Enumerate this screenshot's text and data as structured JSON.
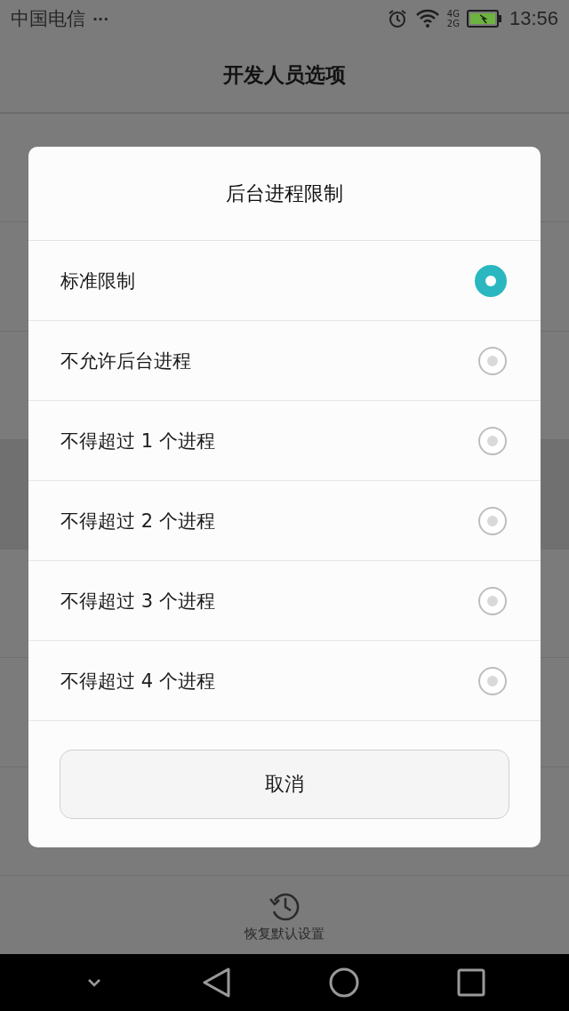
{
  "status_bar": {
    "carrier": "中国电信",
    "more": "···",
    "net_top": "4G",
    "net_bottom": "2G",
    "time": "13:56"
  },
  "header": {
    "title": "开发人员选项"
  },
  "dialog": {
    "title": "后台进程限制",
    "options": [
      {
        "label": "标准限制",
        "selected": true
      },
      {
        "label": "不允许后台进程",
        "selected": false
      },
      {
        "label": "不得超过 1 个进程",
        "selected": false
      },
      {
        "label": "不得超过 2 个进程",
        "selected": false
      },
      {
        "label": "不得超过 3 个进程",
        "selected": false
      },
      {
        "label": "不得超过 4 个进程",
        "selected": false
      }
    ],
    "cancel": "取消"
  },
  "footer": {
    "restore": "恢复默认设置"
  }
}
